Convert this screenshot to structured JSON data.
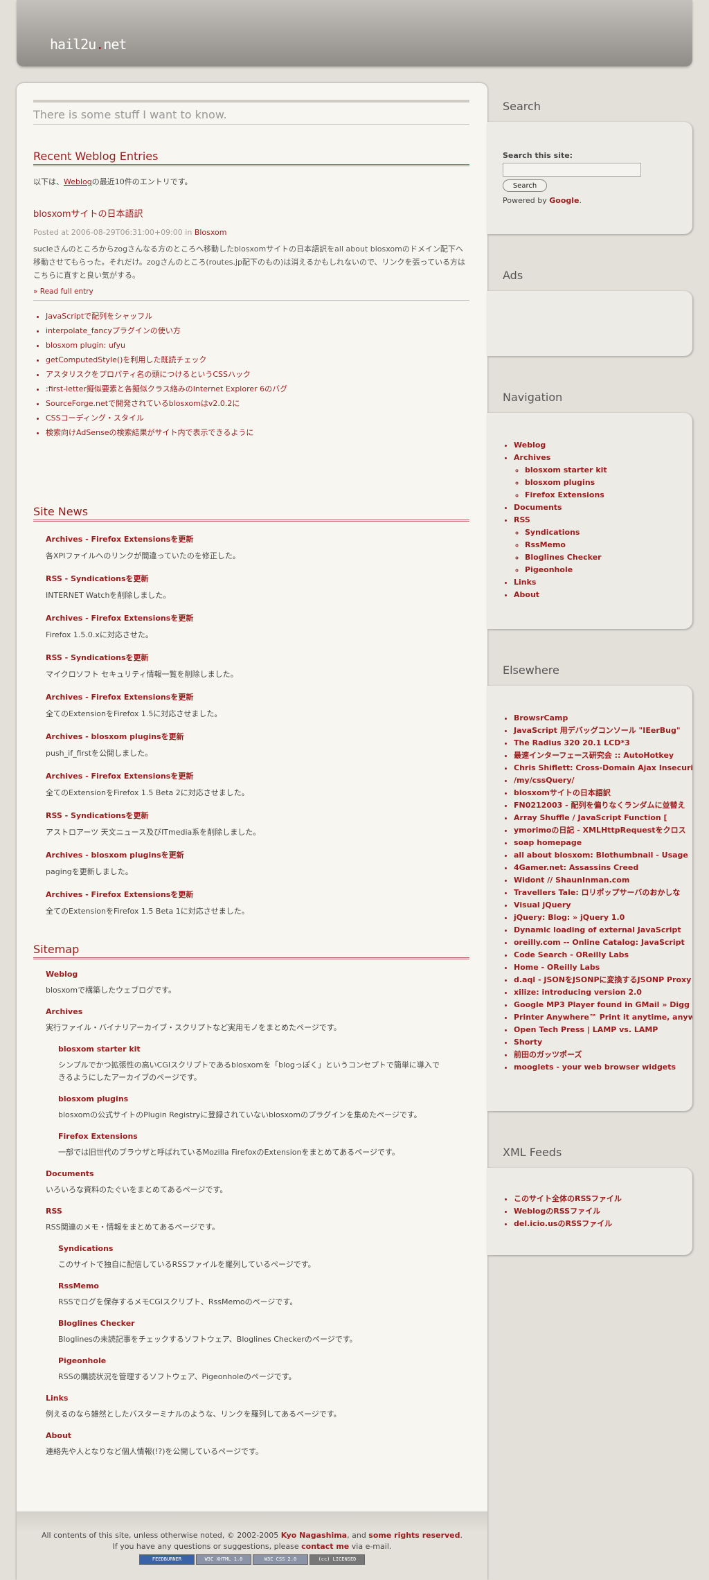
{
  "header": {
    "logo_a": "hail2u",
    "logo_dot": ".",
    "logo_b": "net"
  },
  "tagline": "There is some stuff I want to know.",
  "recent": {
    "heading": "Recent Weblog Entries",
    "intro_pre": "以下は、",
    "intro_link": "Weblog",
    "intro_post": "の最近10件のエントリです。",
    "entry_title": "blosxomサイトの日本語訳",
    "meta_pre": "Posted at 2006-08-29T06:31:00+09:00 in ",
    "meta_cat": "Blosxom",
    "entry_text": "sucleさんのところからzogさんなる方のところへ移動したblosxomサイトの日本語訳をall about blosxomのドメイン配下へ移動させてもらった。それだけ。zogさんのところ(routes.jp配下のもの)は消えるかもしれないので、リンクを張っている方はこちらに直すと良い気がする。",
    "read_full": "» Read full entry",
    "items": [
      "JavaScriptで配列をシャッフル",
      "interpolate_fancyプラグインの使い方",
      "blosxom plugin: ufyu",
      "getComputedStyle()を利用した既読チェック",
      "アスタリスクをプロパティ名の頭につけるというCSSハック",
      ":first-letter擬似要素と各擬似クラス絡みのInternet Explorer 6のバグ",
      "SourceForge.netで開発されているblosxomはv2.0.2に",
      "CSSコーディング・スタイル",
      "検索向けAdSenseの検索結果がサイト内で表示できるように"
    ]
  },
  "news": {
    "heading": "Site News",
    "items": [
      {
        "title": "Archives - Firefox Extensionsを更新",
        "desc": "各XPIファイルへのリンクが間違っていたのを修正した。"
      },
      {
        "title": "RSS - Syndicationsを更新",
        "desc": "INTERNET Watchを削除しました。"
      },
      {
        "title": "Archives - Firefox Extensionsを更新",
        "desc": "Firefox 1.5.0.xに対応させた。"
      },
      {
        "title": "RSS - Syndicationsを更新",
        "desc": "マイクロソフト セキュリティ情報一覧を削除しました。"
      },
      {
        "title": "Archives - Firefox Extensionsを更新",
        "desc": "全てのExtensionをFirefox 1.5に対応させました。"
      },
      {
        "title": "Archives - blosxom pluginsを更新",
        "desc": "push_if_firstを公開しました。"
      },
      {
        "title": "Archives - Firefox Extensionsを更新",
        "desc": "全てのExtensionをFirefox 1.5 Beta 2に対応させました。"
      },
      {
        "title": "RSS - Syndicationsを更新",
        "desc": "アストロアーツ 天文ニュース及びITmedia系を削除しました。"
      },
      {
        "title": "Archives - blosxom pluginsを更新",
        "desc": "pagingを更新しました。"
      },
      {
        "title": "Archives - Firefox Extensionsを更新",
        "desc": "全てのExtensionをFirefox 1.5 Beta 1に対応させました。"
      }
    ]
  },
  "sitemap": {
    "heading": "Sitemap",
    "items": [
      {
        "title": "Weblog",
        "desc": "blosxomで構築したウェブログです。",
        "sub": false
      },
      {
        "title": "Archives",
        "desc": "実行ファイル・バイナリアーカイブ・スクリプトなど実用モノをまとめたページです。",
        "sub": false
      },
      {
        "title": "blosxom starter kit",
        "desc": "シンプルでかつ拡張性の高いCGIスクリプトであるblosxomを「blogっぽく」というコンセプトで簡単に導入できるようにしたアーカイブのページです。",
        "sub": true
      },
      {
        "title": "blosxom plugins",
        "desc": "blosxomの公式サイトのPlugin Registryに登録されていないblosxomのプラグインを集めたページです。",
        "sub": true
      },
      {
        "title": "Firefox Extensions",
        "desc": "一部では旧世代のブラウザと呼ばれているMozilla FirefoxのExtensionをまとめてあるページです。",
        "sub": true
      },
      {
        "title": "Documents",
        "desc": "いろいろな資料のたぐいをまとめてあるページです。",
        "sub": false
      },
      {
        "title": "RSS",
        "desc": "RSS関連のメモ・情報をまとめてあるページです。",
        "sub": false
      },
      {
        "title": "Syndications",
        "desc": "このサイトで独自に配信しているRSSファイルを羅列しているページです。",
        "sub": true
      },
      {
        "title": "RssMemo",
        "desc": "RSSでログを保存するメモCGIスクリプト、RssMemoのページです。",
        "sub": true
      },
      {
        "title": "Bloglines Checker",
        "desc": "Bloglinesの未読記事をチェックするソフトウェア、Bloglines Checkerのページです。",
        "sub": true
      },
      {
        "title": "Pigeonhole",
        "desc": "RSSの購読状況を管理するソフトウェア、Pigeonholeのページです。",
        "sub": true
      },
      {
        "title": "Links",
        "desc": "例えるのなら雑然としたバスターミナルのような、リンクを羅列してあるページです。",
        "sub": false
      },
      {
        "title": "About",
        "desc": "連絡先や人となりなど個人情報(!?)を公開しているページです。",
        "sub": false
      }
    ]
  },
  "footer": {
    "line1_pre": "All contents of this site, unless otherwise noted, © 2002-2005 ",
    "author": "Kyo Nagashima",
    "line1_mid": ", and ",
    "rights": "some rights reserved",
    "line1_post": ".",
    "line2_pre": "If you have any questions or suggestions, please ",
    "contact": "contact me",
    "line2_post": " via e-mail.",
    "badges": [
      "FEEDBURNER",
      "W3C XHTML 1.0",
      "W3C CSS 2.0",
      "(cc) LICENSED"
    ]
  },
  "sidebar": {
    "search": {
      "heading": "Search",
      "label": "Search this site:",
      "button": "Search",
      "powered_pre": "Powered by ",
      "powered_google": "Google",
      "powered_post": "."
    },
    "ads": {
      "heading": "Ads"
    },
    "nav": {
      "heading": "Navigation",
      "items": [
        {
          "label": "Weblog",
          "children": []
        },
        {
          "label": "Archives",
          "children": [
            "blosxom starter kit",
            "blosxom plugins",
            "Firefox Extensions"
          ]
        },
        {
          "label": "Documents",
          "children": []
        },
        {
          "label": "RSS",
          "children": [
            "Syndications",
            "RssMemo",
            "Bloglines Checker",
            "Pigeonhole"
          ]
        },
        {
          "label": "Links",
          "children": []
        },
        {
          "label": "About",
          "children": []
        }
      ]
    },
    "elsewhere": {
      "heading": "Elsewhere",
      "items": [
        "BrowsrCamp",
        "JavaScript 用デバッグコンソール \"IEerBug\"",
        "The Radius 320 20.1 LCD*3",
        "最速インターフェース研究会 :: AutoHotkey",
        "Chris Shiflett: Cross-Domain Ajax Insecurity",
        "/my/cssQuery/",
        "blosxomサイトの日本語訳",
        "FN0212003 - 配列を偏りなくランダムに並替え",
        "Array Shuffle / JavaScript Function [",
        "ymorimoの日記 - XMLHttpRequestをクロス",
        "soap homepage",
        "all about blosxom: Blothumbnail - Usage",
        "4Gamer.net: Assassins Creed",
        "Widont // ShaunInman.com",
        "Travellers Tale: ロリポップサーバのおかしな",
        "Visual jQuery",
        "jQuery: Blog: » jQuery 1.0",
        "Dynamic loading of external JavaScript",
        "oreilly.com -- Online Catalog: JavaScript",
        "Code Search - OReilly Labs",
        "Home - OReilly Labs",
        "d.aql - JSONをJSONPに変換するJSONP Proxy",
        "xilize: introducing version 2.0",
        "Google MP3 Player found in GMail » Digg",
        "Printer Anywhere™ Print it anytime, anywhere",
        "Open Tech Press | LAMP vs. LAMP",
        "Shorty",
        "前田のガッツポーズ",
        "mooglets - your web browser widgets"
      ]
    },
    "feeds": {
      "heading": "XML Feeds",
      "items": [
        "このサイト全体のRSSファイル",
        "WeblogのRSSファイル",
        "del.icio.usのRSSファイル"
      ]
    }
  },
  "colors": {
    "accent": "#9a1c1c",
    "background": "#e3e0d9",
    "panel": "#f7f6f1"
  }
}
